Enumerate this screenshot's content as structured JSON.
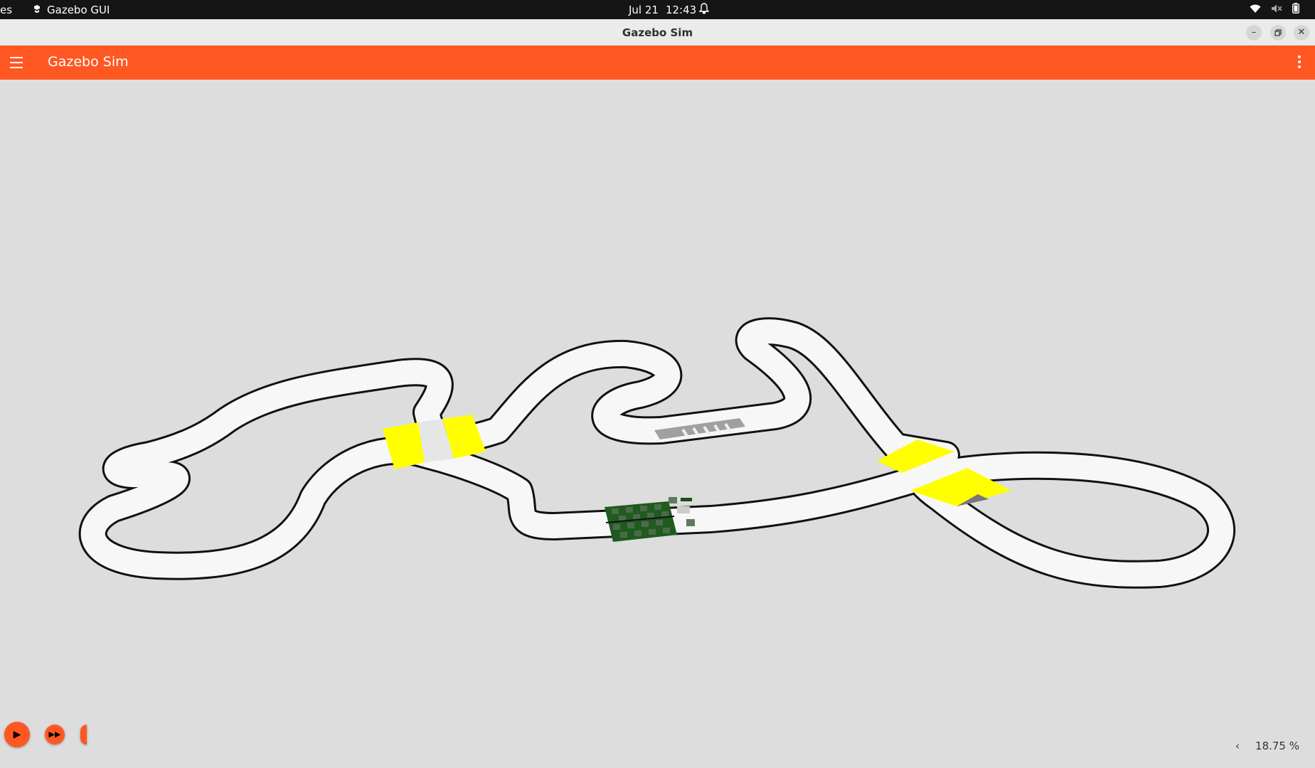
{
  "topbar": {
    "activities_label": "es",
    "app_name": "Gazebo GUI",
    "date": "Jul 21",
    "time": "12:43",
    "icons": [
      "app-icon",
      "bell-icon",
      "wifi-icon",
      "volume-muted-icon",
      "battery-icon"
    ]
  },
  "window": {
    "title": "Gazebo Sim",
    "buttons": [
      "minimize-icon",
      "restore-icon",
      "close-icon"
    ]
  },
  "app_header": {
    "title": "Gazebo Sim",
    "color": "#ff5722",
    "icons": [
      "hamburger-icon",
      "more-vert-icon"
    ]
  },
  "scene": {
    "background_color": "#dddddd",
    "track_color": "#f7f7f7",
    "track_border_color": "#111111",
    "ramp_color": "#ffff00",
    "start_pad_colors": [
      "#1f5b1f",
      "#4a6b4a"
    ],
    "crosswalk_color": "#9a9a9a"
  },
  "playback": {
    "icons": [
      "play-icon",
      "step-forward-icon"
    ]
  },
  "status": {
    "collapse_icon": "chevron-left-icon",
    "real_time_factor": "18.75 %"
  }
}
